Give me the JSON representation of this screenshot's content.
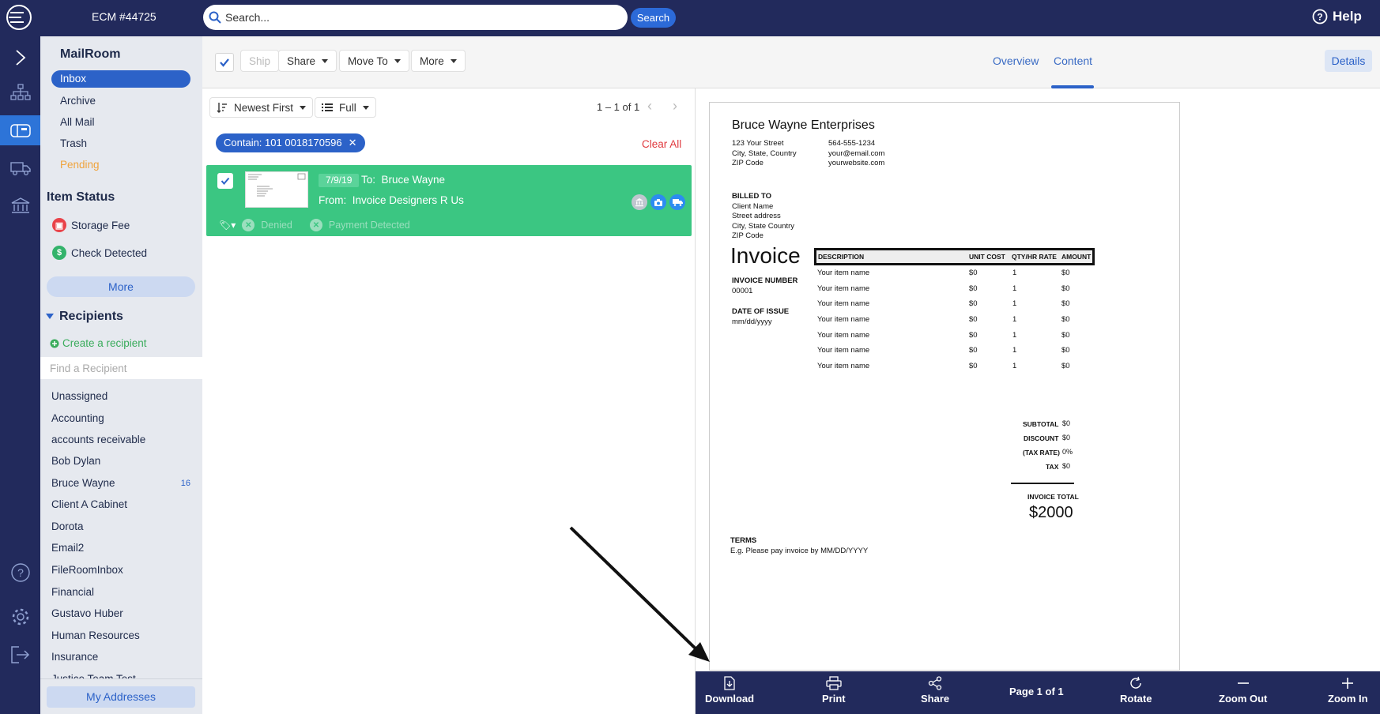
{
  "header": {
    "account": "ECM #44725",
    "search_placeholder": "Search...",
    "search_button": "Search",
    "help": "Help"
  },
  "sidebar": {
    "title": "MailRoom",
    "folders": [
      {
        "label": "Inbox",
        "active": true
      },
      {
        "label": "Archive"
      },
      {
        "label": "All Mail"
      },
      {
        "label": "Trash"
      },
      {
        "label": "Pending"
      }
    ],
    "item_status_title": "Item Status",
    "statuses": [
      {
        "label": "Storage Fee",
        "color": "#e9434a"
      },
      {
        "label": "Check Detected",
        "color": "#33b36b"
      }
    ],
    "more_button": "More",
    "recipients_title": "Recipients",
    "create_recipient": "Create a recipient",
    "find_placeholder": "Find a Recipient",
    "recipients": [
      {
        "name": "Unassigned",
        "count": ""
      },
      {
        "name": "Accounting",
        "count": ""
      },
      {
        "name": "accounts receivable",
        "count": ""
      },
      {
        "name": "Bob Dylan",
        "count": ""
      },
      {
        "name": "Bruce Wayne",
        "count": "16"
      },
      {
        "name": "Client A Cabinet",
        "count": ""
      },
      {
        "name": "Dorota",
        "count": ""
      },
      {
        "name": "Email2",
        "count": ""
      },
      {
        "name": "FileRoomInbox",
        "count": ""
      },
      {
        "name": "Financial",
        "count": ""
      },
      {
        "name": "Gustavo Huber",
        "count": ""
      },
      {
        "name": "Human Resources",
        "count": ""
      },
      {
        "name": "Insurance",
        "count": ""
      },
      {
        "name": "Justice Team Test",
        "count": ""
      }
    ],
    "my_addresses": "My Addresses"
  },
  "toolbar": {
    "ship": "Ship",
    "share": "Share",
    "move_to": "Move To",
    "more": "More",
    "overview": "Overview",
    "content": "Content",
    "details": "Details"
  },
  "list": {
    "sort": "Newest First",
    "view": "Full",
    "pager": "1 – 1 of 1",
    "filter_chip": "Contain: 101 0018170596",
    "clear_all": "Clear All",
    "item": {
      "date": "7/9/19",
      "to_label": "To:",
      "to": "Bruce Wayne",
      "from_label": "From:",
      "from": "Invoice Designers R Us",
      "tag1": "Denied",
      "tag2": "Payment Detected"
    }
  },
  "document": {
    "company": "Bruce Wayne Enterprises",
    "address": [
      "123 Your Street",
      "City, State, Country",
      "ZIP Code"
    ],
    "contact": [
      "564-555-1234",
      "your@email.com",
      "yourwebsite.com"
    ],
    "billed_to_label": "BILLED TO",
    "billed_to": [
      "Client Name",
      "Street address",
      "City, State Country",
      "ZIP Code"
    ],
    "title": "Invoice",
    "invoice_number_label": "INVOICE NUMBER",
    "invoice_number": "00001",
    "date_label": "DATE OF ISSUE",
    "date": "mm/dd/yyyy",
    "columns": [
      "DESCRIPTION",
      "UNIT COST",
      "QTY/HR RATE",
      "AMOUNT"
    ],
    "rows": [
      [
        "Your item name",
        "$0",
        "1",
        "$0"
      ],
      [
        "Your item name",
        "$0",
        "1",
        "$0"
      ],
      [
        "Your item name",
        "$0",
        "1",
        "$0"
      ],
      [
        "Your item name",
        "$0",
        "1",
        "$0"
      ],
      [
        "Your item name",
        "$0",
        "1",
        "$0"
      ],
      [
        "Your item name",
        "$0",
        "1",
        "$0"
      ],
      [
        "Your item name",
        "$0",
        "1",
        "$0"
      ]
    ],
    "subtotal_label": "SUBTOTAL",
    "subtotal": "$0",
    "discount_label": "DISCOUNT",
    "discount": "$0",
    "tax_rate_label": "(TAX RATE)",
    "tax_rate": "0%",
    "tax_label": "TAX",
    "tax": "$0",
    "total_label": "INVOICE TOTAL",
    "total": "$2000",
    "terms_label": "TERMS",
    "terms": "E.g. Please pay invoice by MM/DD/YYYY"
  },
  "viewer": {
    "download": "Download",
    "print": "Print",
    "share": "Share",
    "page": "Page 1 of 1",
    "rotate": "Rotate",
    "zoom_out": "Zoom Out",
    "zoom_in": "Zoom In"
  },
  "colors": {
    "nav": "#222a5c",
    "accent": "#2c62c8",
    "row": "#3bc682"
  }
}
